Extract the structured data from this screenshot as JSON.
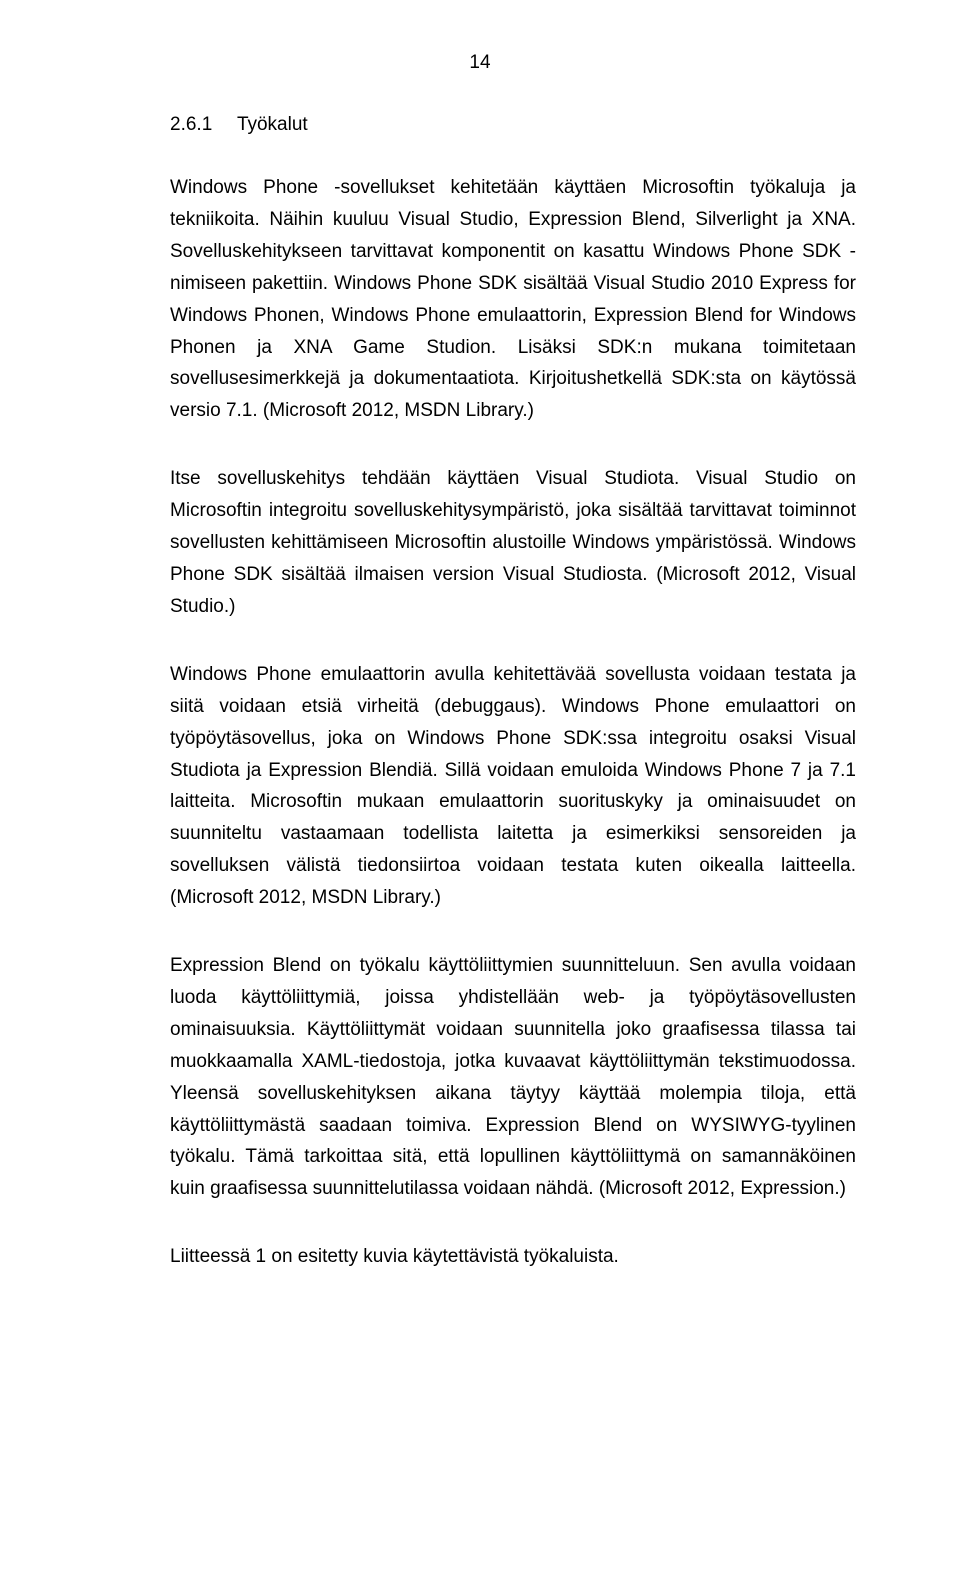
{
  "page_number": "14",
  "heading": {
    "number": "2.6.1",
    "title": "Työkalut"
  },
  "paragraphs": {
    "p1": "Windows Phone -sovellukset kehitetään käyttäen Microsoftin työkaluja ja tekniikoita. Näihin kuuluu Visual Studio, Expression Blend, Silverlight ja XNA. Sovelluskehitykseen tarvittavat komponentit on kasattu Windows Phone SDK -nimiseen pakettiin. Windows Phone SDK sisältää Visual Studio 2010 Express for Windows Phonen, Windows Phone emulaattorin, Expression Blend for Windows Phonen ja XNA Game Studion. Lisäksi SDK:n mukana toimitetaan sovellusesimerkkejä ja dokumentaatiota. Kirjoitushetkellä SDK:sta on käytössä versio 7.1. (Microsoft 2012, MSDN Library.)",
    "p2": "Itse sovelluskehitys tehdään käyttäen Visual Studiota. Visual Studio on Microsoftin integroitu sovelluskehitysympäristö, joka sisältää tarvittavat toiminnot sovellusten kehittämiseen Microsoftin alustoille Windows ympäristössä. Windows Phone SDK sisältää ilmaisen version Visual Studiosta. (Microsoft 2012, Visual Studio.)",
    "p3": "Windows Phone emulaattorin avulla kehitettävää sovellusta voidaan testata ja siitä voidaan etsiä virheitä (debuggaus). Windows Phone emulaattori on työpöytäsovellus, joka on Windows Phone SDK:ssa integroitu osaksi Visual Studiota ja Expression Blendiä. Sillä voidaan emuloida Windows Phone 7 ja 7.1 laitteita. Microsoftin mukaan emulaattorin suorituskyky ja ominaisuudet on suunniteltu vastaamaan todellista laitetta ja esimerkiksi sensoreiden ja sovelluksen välistä tiedonsiirtoa voidaan testata kuten oikealla laitteella. (Microsoft 2012, MSDN Library.)",
    "p4": "Expression Blend on työkalu käyttöliittymien suunnitteluun. Sen avulla voidaan luoda käyttöliittymiä, joissa yhdistellään web- ja työpöytäsovellusten ominaisuuksia. Käyttöliittymät voidaan suunnitella joko graafisessa tilassa tai muokkaamalla XAML-tiedostoja, jotka kuvaavat käyttöliittymän tekstimuodossa. Yleensä sovelluskehityksen aikana täytyy käyttää molempia tiloja, että käyttöliittymästä saadaan toimiva. Expression Blend on WYSIWYG-tyylinen työkalu. Tämä tarkoittaa sitä, että lopullinen käyttöliittymä on samannäköinen kuin graafisessa suunnittelutilassa voidaan nähdä. (Microsoft 2012, Expression.)",
    "p5": "Liitteessä 1 on esitetty kuvia käytettävistä työkaluista."
  }
}
